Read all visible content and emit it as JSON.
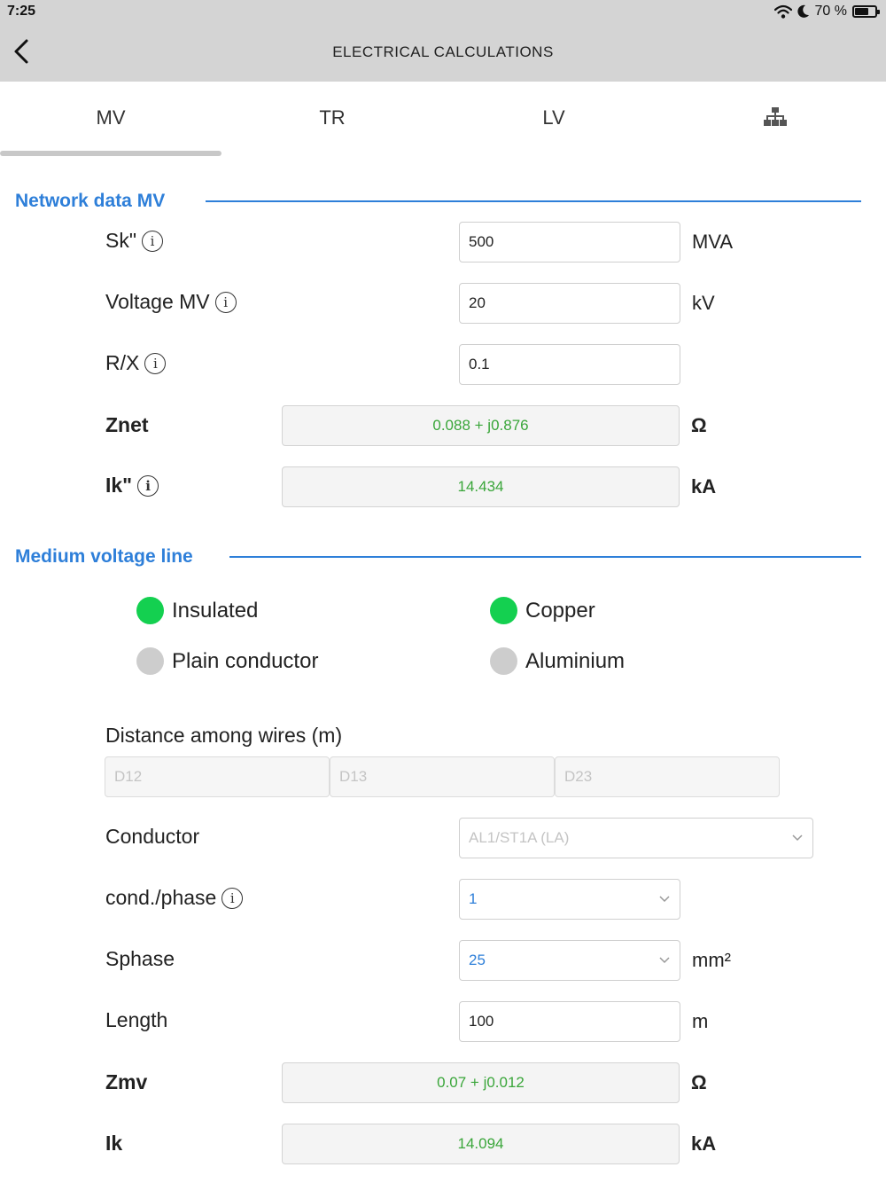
{
  "status": {
    "time": "7:25",
    "battery": "70 %",
    "battery_level": 0.7
  },
  "header": {
    "title": "ELECTRICAL CALCULATIONS",
    "back_icon": "chevron-left-icon"
  },
  "tabs": [
    {
      "label": "MV",
      "active": true
    },
    {
      "label": "TR",
      "active": false
    },
    {
      "label": "LV",
      "active": false
    },
    {
      "label": "",
      "icon": "network-hierarchy-icon",
      "active": false
    }
  ],
  "network": {
    "title": "Network data MV",
    "sk_label": "Sk\"",
    "sk_value": "500",
    "sk_unit": "MVA",
    "voltage_label": "Voltage MV",
    "voltage_value": "20",
    "voltage_unit": "kV",
    "rx_label": "R/X",
    "rx_value": "0.1",
    "znet_label": "Znet",
    "znet_value": "0.088 + j0.876",
    "znet_unit": "Ω",
    "ik_label": "Ik\"",
    "ik_value": "14.434",
    "ik_unit": "kA"
  },
  "line": {
    "title": "Medium voltage line",
    "radio_insulated": "Insulated",
    "radio_plain": "Plain conductor",
    "radio_copper": "Copper",
    "radio_aluminium": "Aluminium",
    "insulated_selected": true,
    "copper_selected": true,
    "distance_label": "Distance among wires (m)",
    "d12_placeholder": "D12",
    "d13_placeholder": "D13",
    "d23_placeholder": "D23",
    "conductor_label": "Conductor",
    "conductor_value": "AL1/ST1A (LA)",
    "condphase_label": "cond./phase",
    "condphase_value": "1",
    "sphase_label": "Sphase",
    "sphase_value": "25",
    "sphase_unit": "mm²",
    "length_label": "Length",
    "length_value": "100",
    "length_unit": "m",
    "zmv_label": "Zmv",
    "zmv_value": "0.07 + j0.012",
    "zmv_unit": "Ω",
    "ik_label": "Ik",
    "ik_value": "14.094",
    "ik_unit": "kA"
  },
  "colors": {
    "accent": "#2e7fd9",
    "result_text": "#3aa63a",
    "radio_on": "#14d050",
    "radio_off": "#cdcdcd",
    "select_value": "#2e7fd9"
  }
}
